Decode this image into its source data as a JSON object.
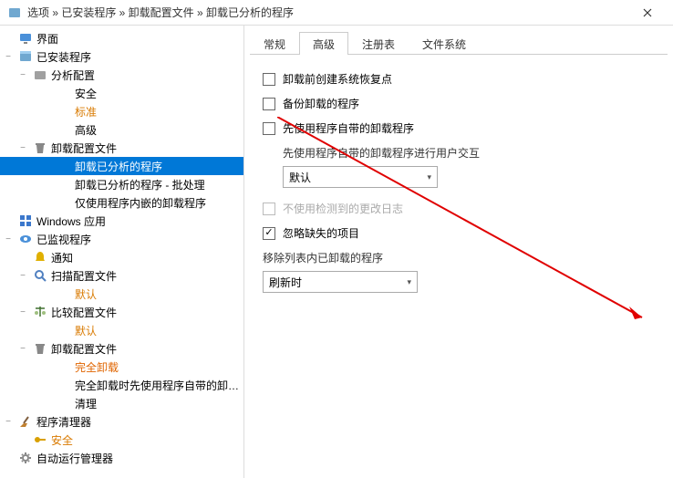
{
  "titlebar": {
    "breadcrumb": "选项 »  已安装程序 »  卸载配置文件 »  卸载已分析的程序"
  },
  "sidebar": {
    "items": [
      {
        "label": "界面",
        "depth": 0,
        "icon": "monitor",
        "exp": ""
      },
      {
        "label": "已安装程序",
        "depth": 0,
        "icon": "box",
        "exp": "−"
      },
      {
        "label": "分析配置",
        "depth": 1,
        "icon": "box-o",
        "exp": "−"
      },
      {
        "label": "安全",
        "depth": 2,
        "icon": "",
        "exp": ""
      },
      {
        "label": "标准",
        "depth": 2,
        "icon": "",
        "exp": "",
        "cls": "orange"
      },
      {
        "label": "高级",
        "depth": 2,
        "icon": "",
        "exp": ""
      },
      {
        "label": "卸载配置文件",
        "depth": 1,
        "icon": "trash",
        "exp": "−"
      },
      {
        "label": "卸载已分析的程序",
        "depth": 2,
        "icon": "",
        "exp": "",
        "selected": true
      },
      {
        "label": "卸载已分析的程序 - 批处理",
        "depth": 2,
        "icon": "",
        "exp": ""
      },
      {
        "label": "仅使用程序内嵌的卸载程序",
        "depth": 2,
        "icon": "",
        "exp": ""
      },
      {
        "label": "Windows 应用",
        "depth": 0,
        "icon": "win",
        "exp": ""
      },
      {
        "label": "已监视程序",
        "depth": 0,
        "icon": "eye",
        "exp": "−"
      },
      {
        "label": "通知",
        "depth": 1,
        "icon": "bell",
        "exp": ""
      },
      {
        "label": "扫描配置文件",
        "depth": 1,
        "icon": "search",
        "exp": "−"
      },
      {
        "label": "默认",
        "depth": 2,
        "icon": "",
        "exp": "",
        "cls": "orange"
      },
      {
        "label": "比较配置文件",
        "depth": 1,
        "icon": "scale",
        "exp": "−"
      },
      {
        "label": "默认",
        "depth": 2,
        "icon": "",
        "exp": "",
        "cls": "orange"
      },
      {
        "label": "卸载配置文件",
        "depth": 1,
        "icon": "trash",
        "exp": "−"
      },
      {
        "label": "完全卸载",
        "depth": 2,
        "icon": "",
        "exp": "",
        "cls": "orange-red"
      },
      {
        "label": "完全卸载时先使用程序自带的卸…",
        "depth": 2,
        "icon": "",
        "exp": ""
      },
      {
        "label": "清理",
        "depth": 2,
        "icon": "",
        "exp": ""
      },
      {
        "label": "程序清理器",
        "depth": 0,
        "icon": "broom",
        "exp": "−"
      },
      {
        "label": "安全",
        "depth": 1,
        "icon": "key",
        "exp": "",
        "cls": "orange"
      },
      {
        "label": "自动运行管理器",
        "depth": 0,
        "icon": "gear",
        "exp": ""
      }
    ]
  },
  "tabs": [
    {
      "label": "常规",
      "active": false
    },
    {
      "label": "高级",
      "active": true
    },
    {
      "label": "注册表",
      "active": false
    },
    {
      "label": "文件系统",
      "active": false
    }
  ],
  "panel": {
    "cb1": {
      "label": "卸载前创建系统恢复点",
      "checked": false
    },
    "cb2": {
      "label": "备份卸载的程序",
      "checked": false
    },
    "cb3": {
      "label": "先使用程序自带的卸载程序",
      "checked": false
    },
    "cb3_sub": {
      "label": "先使用程序自带的卸载程序进行用户交互",
      "select_value": "默认"
    },
    "cb4": {
      "label": "不使用检测到的更改日志",
      "checked": false,
      "disabled": true
    },
    "cb5": {
      "label": "忽略缺失的项目",
      "checked": true
    },
    "section2": {
      "label": "移除列表内已卸载的程序",
      "select_value": "刷新时"
    }
  }
}
